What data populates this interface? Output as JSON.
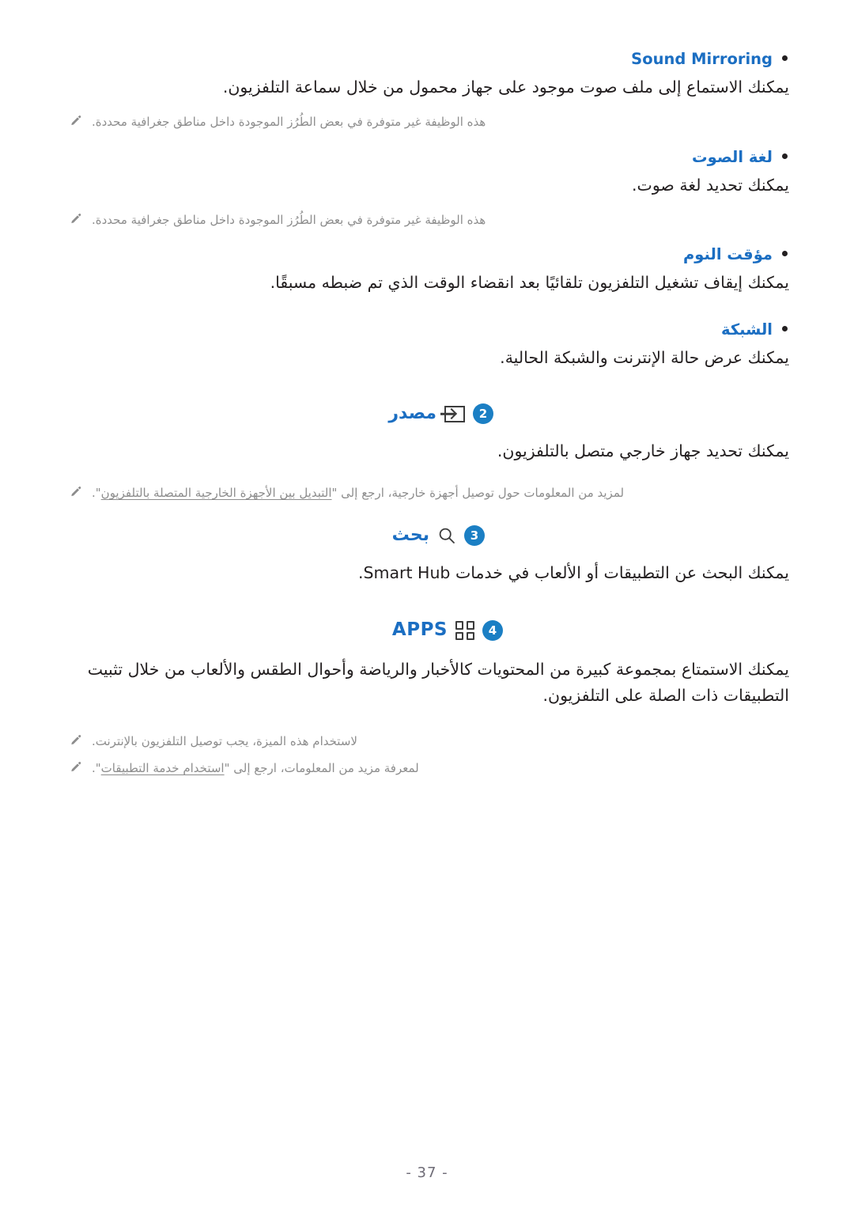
{
  "page": {
    "number_label": "- 37 -",
    "colors": {
      "heading_blue": "#1b6ec2",
      "badge_blue": "#1b7fc4",
      "body_text": "#231f20",
      "note_grey": "#8d8d8d",
      "icon_dark": "#3c3c3c"
    }
  },
  "bullets": [
    {
      "title": "Sound Mirroring",
      "desc": "يمكنك الاستماع إلى ملف صوت موجود على جهاز محمول من خلال سماعة التلفزيون.",
      "note": "هذه الوظيفة غير متوفرة في بعض الطُرُز الموجودة داخل مناطق جغرافية محددة."
    },
    {
      "title": "لغة الصوت",
      "desc": "يمكنك تحديد لغة صوت.",
      "note": "هذه الوظيفة غير متوفرة في بعض الطُرُز الموجودة داخل مناطق جغرافية محددة."
    },
    {
      "title": "مؤقت النوم",
      "desc": "يمكنك إيقاف تشغيل التلفزيون تلقائيًا بعد انقضاء الوقت الذي تم ضبطه مسبقًا.",
      "note": null
    },
    {
      "title": "الشبكة",
      "desc": "يمكنك عرض حالة الإنترنت والشبكة الحالية.",
      "note": null
    }
  ],
  "sections": [
    {
      "badge": "2",
      "icon": "source-input-icon",
      "title": "مصدر",
      "desc": "يمكنك تحديد جهاز خارجي متصل بالتلفزيون.",
      "notes": [
        {
          "before": "لمزيد من المعلومات حول توصيل أجهزة خارجية، ارجع إلى \"",
          "link": "التبديل بين الأجهزة الخارجية المتصلة بالتلفزيون",
          "after": "\"."
        }
      ]
    },
    {
      "badge": "3",
      "icon": "search-icon",
      "title": "بحث",
      "desc": "يمكنك البحث عن التطبيقات أو الألعاب في خدمات Smart Hub.",
      "notes": []
    },
    {
      "badge": "4",
      "icon": "apps-grid-icon",
      "title": "APPS",
      "desc": "يمكنك الاستمتاع بمجموعة كبيرة من المحتويات كالأخبار والرياضة وأحوال الطقس والألعاب من خلال تثبيت التطبيقات ذات الصلة على التلفزيون.",
      "notes": [
        {
          "before": "لاستخدام هذه الميزة، يجب توصيل التلفزيون بالإنترنت.",
          "link": null,
          "after": ""
        },
        {
          "before": "لمعرفة مزيد من المعلومات، ارجع إلى \"",
          "link": "استخدام خدمة التطبيقات",
          "after": "\"."
        }
      ]
    }
  ]
}
